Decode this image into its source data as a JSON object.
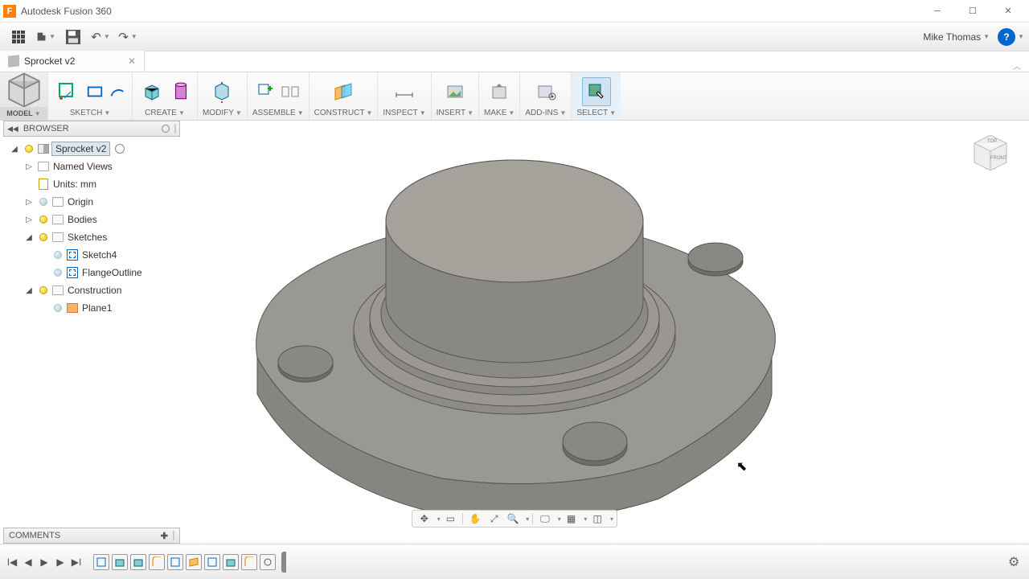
{
  "app": {
    "title": "Autodesk Fusion 360"
  },
  "user": {
    "name": "Mike Thomas"
  },
  "tab": {
    "name": "Sprocket v2"
  },
  "ribbon": {
    "model": "MODEL",
    "sketch": "SKETCH",
    "create": "CREATE",
    "modify": "MODIFY",
    "assemble": "ASSEMBLE",
    "construct": "CONSTRUCT",
    "inspect": "INSPECT",
    "insert": "INSERT",
    "make": "MAKE",
    "addins": "ADD-INS",
    "select": "SELECT"
  },
  "browser": {
    "title": "BROWSER",
    "root": "Sprocket v2",
    "named_views": "Named Views",
    "units": "Units: mm",
    "origin": "Origin",
    "bodies": "Bodies",
    "sketches": "Sketches",
    "sketch4": "Sketch4",
    "flange": "FlangeOutline",
    "construction": "Construction",
    "plane1": "Plane1"
  },
  "comments": {
    "title": "COMMENTS"
  },
  "viewcube": {
    "top": "TOP",
    "front": "FRONT"
  }
}
